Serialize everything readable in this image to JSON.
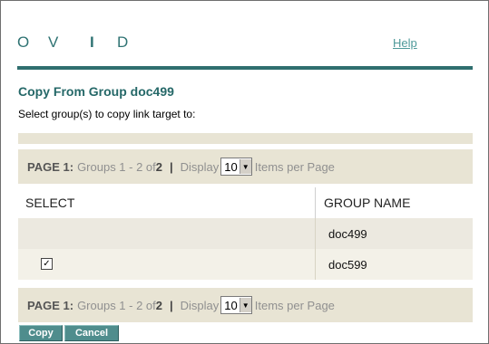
{
  "header": {
    "logo_letters": [
      "O",
      "V",
      "I",
      "D"
    ],
    "help_label": "Help"
  },
  "page": {
    "title": "Copy From Group doc499",
    "subtitle": "Select group(s) to copy link target to:"
  },
  "pager": {
    "page_label": "PAGE 1:",
    "range_text": "Groups 1 - 2 of",
    "total": "2",
    "separator": "|",
    "display_label": "Display",
    "per_page_value": "10",
    "per_page_suffix": "Items per Page"
  },
  "table": {
    "columns": [
      "SELECT",
      "GROUP NAME"
    ],
    "rows": [
      {
        "group_name": "doc499",
        "has_checkbox": false,
        "checked": false
      },
      {
        "group_name": "doc599",
        "has_checkbox": true,
        "checked": true
      }
    ]
  },
  "actions": {
    "copy_label": "Copy",
    "cancel_label": "Cancel"
  },
  "colors": {
    "accent": "#2f7373",
    "band": "#e8e4d4",
    "button": "#4f8d8d"
  },
  "icons": {
    "dropdown": "chevron-down-icon",
    "checkbox": "checkbox-icon"
  }
}
